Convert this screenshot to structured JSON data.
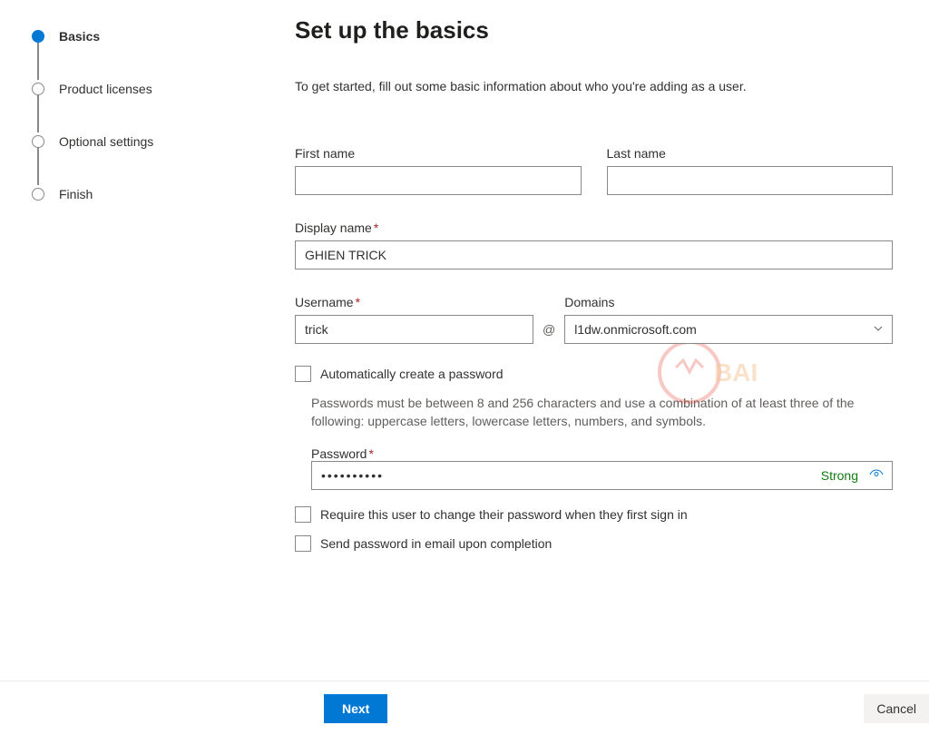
{
  "sidebar": {
    "steps": [
      {
        "label": "Basics",
        "active": true
      },
      {
        "label": "Product licenses",
        "active": false
      },
      {
        "label": "Optional settings",
        "active": false
      },
      {
        "label": "Finish",
        "active": false
      }
    ]
  },
  "main": {
    "title": "Set up the basics",
    "description": "To get started, fill out some basic information about who you're adding as a user.",
    "fields": {
      "first_name_label": "First name",
      "first_name_value": "",
      "last_name_label": "Last name",
      "last_name_value": "",
      "display_name_label": "Display name",
      "display_name_value": "GHIEN TRICK",
      "username_label": "Username",
      "username_value": "trick",
      "at_symbol": "@",
      "domains_label": "Domains",
      "domains_value": "l1dw.onmicrosoft.com",
      "auto_password_label": "Automatically create a password",
      "password_hint": "Passwords must be between 8 and 256 characters and use a combination of at least three of the following: uppercase letters, lowercase letters, numbers, and symbols.",
      "password_label": "Password",
      "password_value": "••••••••••",
      "password_strength": "Strong",
      "require_change_label": "Require this user to change their password when they first sign in",
      "send_email_label": "Send password in email upon completion"
    },
    "required_marker": "*"
  },
  "footer": {
    "next_label": "Next",
    "cancel_label": "Cancel"
  }
}
